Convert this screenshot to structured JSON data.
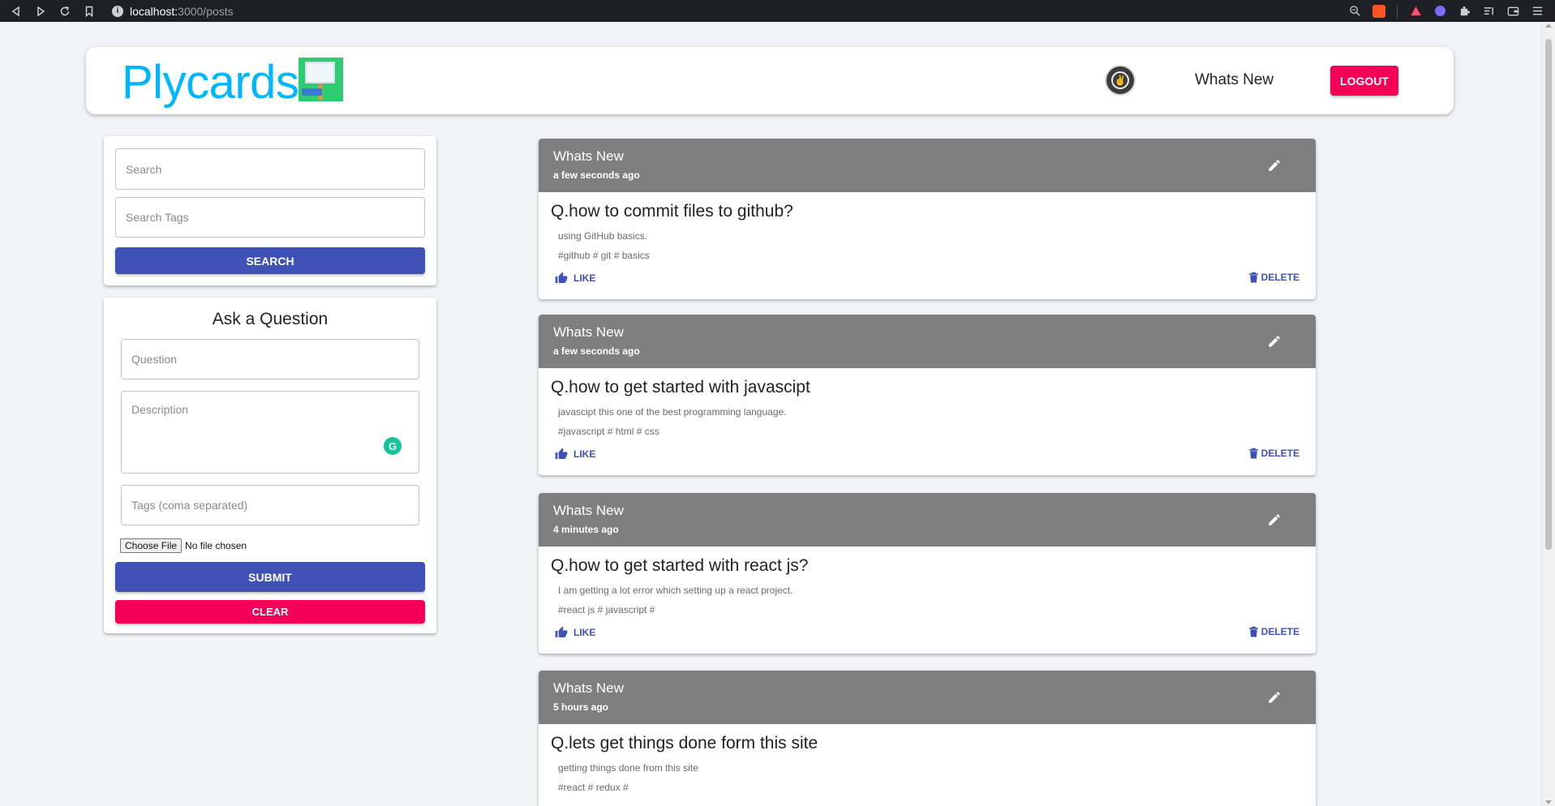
{
  "browser": {
    "url_host": "localhost:",
    "url_path": "3000/posts"
  },
  "header": {
    "brand": "Plycards",
    "nav_title": "Whats New",
    "logout_label": "LOGOUT"
  },
  "search": {
    "search_placeholder": "Search",
    "tags_placeholder": "Search Tags",
    "button_label": "SEARCH"
  },
  "form": {
    "title": "Ask a Question",
    "question_placeholder": "Question",
    "description_placeholder": "Description",
    "tags_placeholder": "Tags (coma separated)",
    "file_button": "Choose File",
    "file_status": "No file chosen",
    "submit_label": "SUBMIT",
    "clear_label": "CLEAR",
    "grammarly_letter": "G"
  },
  "posts": [
    {
      "author": "Whats New",
      "time": "a few seconds ago",
      "question": "Q.how to commit files to github?",
      "description": "using GitHub basics.",
      "tags": "#github # git # basics",
      "like_label": "LIKE",
      "delete_label": "DELETE"
    },
    {
      "author": "Whats New",
      "time": "a few seconds ago",
      "question": "Q.how to get started with javascipt",
      "description": "javascipt this one of the best programming language.",
      "tags": "#javascript # html # css",
      "like_label": "LIKE",
      "delete_label": "DELETE"
    },
    {
      "author": "Whats New",
      "time": "4 minutes ago",
      "question": "Q.how to get started with react js?",
      "description": "I am getting a lot error which setting up a react project.",
      "tags": "#react js # javascript #",
      "like_label": "LIKE",
      "delete_label": "DELETE"
    },
    {
      "author": "Whats New",
      "time": "5 hours ago",
      "question": "Q.lets get things done form this site",
      "description": "getting things done from this site",
      "tags": "#react # redux #",
      "like_label": "LIKE",
      "delete_label": "DELETE"
    }
  ],
  "colors": {
    "brand": "#00b7ff",
    "primary": "#3f51b5",
    "secondary": "#f50057",
    "card_header": "#7f7f7f"
  }
}
